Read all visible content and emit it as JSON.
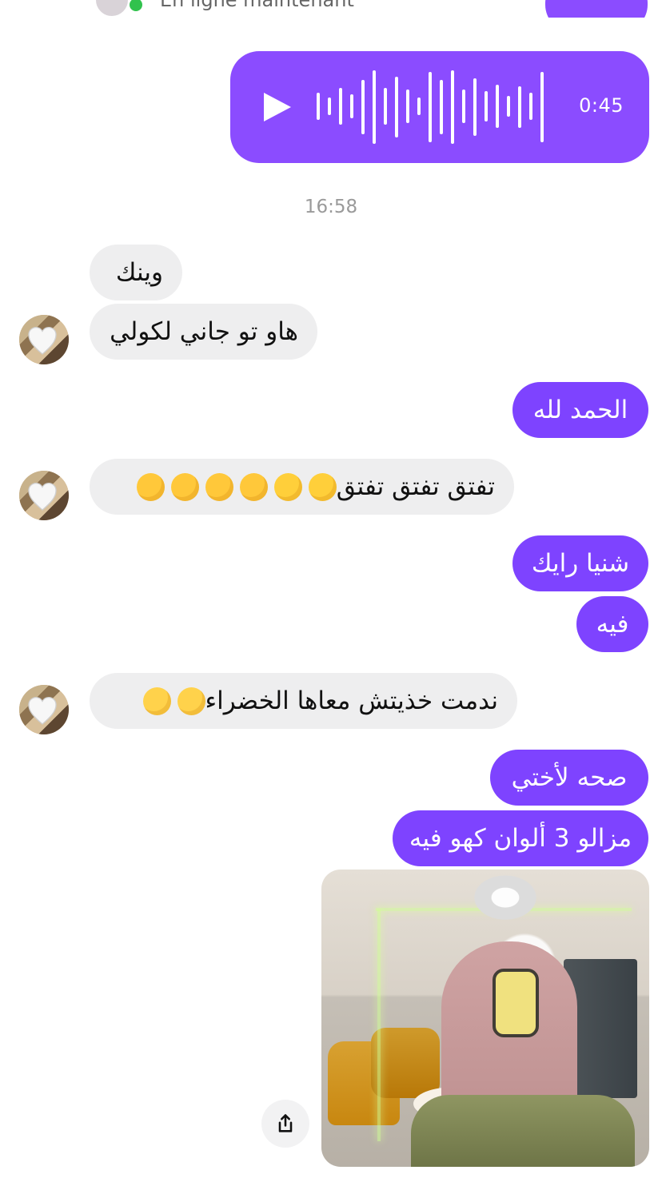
{
  "header": {
    "status_text": "En ligne maintenant"
  },
  "voice_message": {
    "duration": "0:45"
  },
  "timestamp": "16:58",
  "messages": [
    {
      "side": "incoming",
      "text": "وينك"
    },
    {
      "side": "incoming",
      "text": "هاو تو جاني لكولي"
    },
    {
      "side": "outgoing",
      "text": "الحمد لله"
    },
    {
      "side": "incoming",
      "text": "تفتق تفتق تفتق"
    },
    {
      "side": "outgoing",
      "text": "شنيا رايك"
    },
    {
      "side": "outgoing",
      "text": "فيه"
    },
    {
      "side": "incoming",
      "text": "ندمت خذيتش معاها الخضراء"
    },
    {
      "side": "outgoing",
      "text": "صحه لأختي"
    },
    {
      "side": "outgoing",
      "text": "مزالو 3 ألوان كهو فيه"
    }
  ],
  "icons": {
    "play": "play-icon",
    "share": "share-icon",
    "heart": "heart-icon"
  },
  "colors": {
    "accent": "#7e43ff",
    "incoming_bubble": "#eeeeef"
  }
}
